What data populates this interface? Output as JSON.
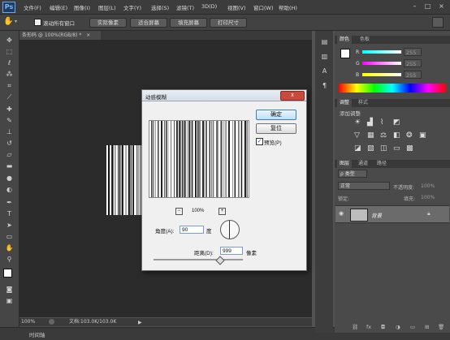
{
  "app": {
    "logo": "Ps"
  },
  "menu": [
    "文件(F)",
    "编辑(E)",
    "图像(I)",
    "图层(L)",
    "文字(Y)",
    "选择(S)",
    "滤镜(T)",
    "3D(D)",
    "视图(V)",
    "窗口(W)",
    "帮助(H)"
  ],
  "window_controls": [
    "–",
    "□",
    "×"
  ],
  "options": {
    "scroll_all_label": "滚动所有窗口",
    "buttons": [
      "实际像素",
      "适合屏幕",
      "填充屏幕",
      "打印尺寸"
    ]
  },
  "document": {
    "tab_label": "条形码 @ 100%(RGB/8) *",
    "tab_close": "×"
  },
  "status": {
    "zoom": "100%",
    "doc_info": "文档:103.0K/103.0K"
  },
  "timeline": {
    "label": "时间轴"
  },
  "color_panel": {
    "tabs": [
      "颜色",
      "色板"
    ],
    "channels": [
      {
        "label": "R",
        "value": "255"
      },
      {
        "label": "G",
        "value": "255"
      },
      {
        "label": "B",
        "value": "255"
      }
    ]
  },
  "adjust_panel": {
    "tabs": [
      "调整",
      "样式"
    ],
    "title": "添加调整"
  },
  "layers_panel": {
    "tabs": [
      "图层",
      "通道",
      "路径"
    ],
    "filter_label": "ρ 类型",
    "blend_mode": "正常",
    "opacity_label": "不透明度:",
    "opacity_value": "100%",
    "lock_label": "锁定:",
    "fill_label": "填充:",
    "fill_value": "100%",
    "layer_name": "背景"
  },
  "dialog": {
    "title": "动感模糊",
    "close": "x",
    "ok": "确定",
    "cancel": "复位",
    "preview_label": "预览(P)",
    "preview_checked": true,
    "zoom_percent": "100%",
    "zoom_out": "−",
    "zoom_in": "+",
    "angle_label": "角度(A):",
    "angle_value": "90",
    "angle_unit": "度",
    "distance_label": "距离(D):",
    "distance_value": "999",
    "distance_unit": "像素"
  }
}
